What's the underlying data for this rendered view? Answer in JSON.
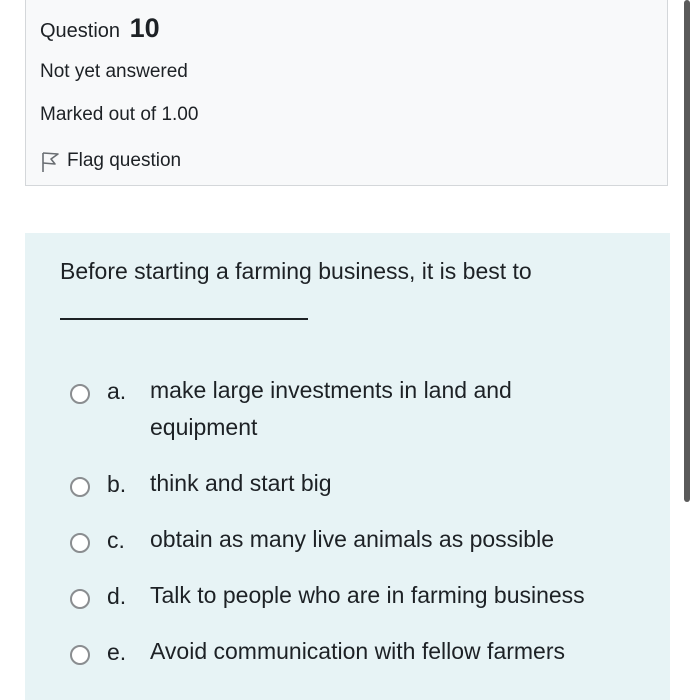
{
  "info": {
    "question_label": "Question",
    "question_number": "10",
    "state": "Not yet answered",
    "grade": "Marked out of 1.00",
    "flag_label": "Flag question"
  },
  "question": {
    "text": "Before starting a farming business, it is best to"
  },
  "answers": [
    {
      "letter": "a.",
      "text": "make large investments in land and equipment"
    },
    {
      "letter": "b.",
      "text": "think and start big"
    },
    {
      "letter": "c.",
      "text": "obtain as many live animals as possible"
    },
    {
      "letter": "d.",
      "text": "Talk to people who are in farming business"
    },
    {
      "letter": "e.",
      "text": "Avoid communication with fellow farmers"
    }
  ],
  "colors": {
    "info_background": "#f8f9fa",
    "content_background": "#e7f3f5",
    "text": "#1d2125"
  }
}
